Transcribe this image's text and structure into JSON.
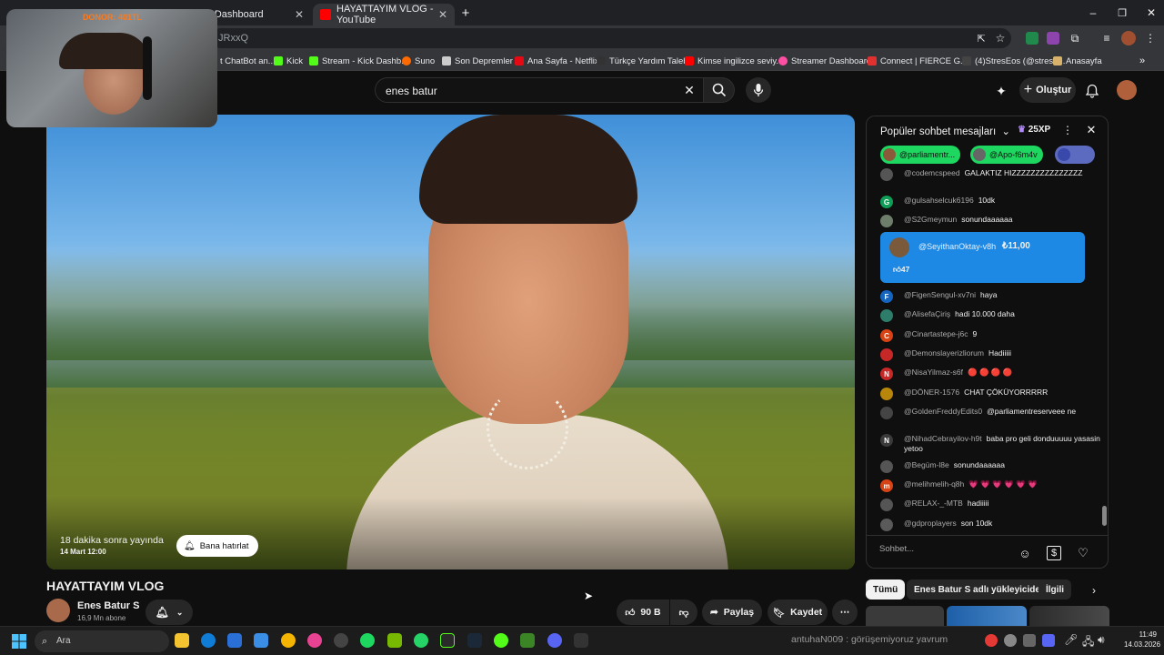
{
  "browser": {
    "tabs": [
      {
        "label": "Kick Dashboard",
        "icon_color": "#53fc18"
      },
      {
        "label": "HAYATTAYIM VLOG - YouTube",
        "icon_color": "#ff0000"
      }
    ],
    "new_tab_label": "+",
    "address": "JRxxQ",
    "bookmarks": [
      {
        "label": "t ChatBot an...",
        "color": "#aaaaaa"
      },
      {
        "label": "Kick",
        "color": "#53fc18"
      },
      {
        "label": "Stream - Kick Dashb...",
        "color": "#53fc18"
      },
      {
        "label": "Suno",
        "color": "#ff6a00"
      },
      {
        "label": "Son Depremler",
        "color": "#cccccc"
      },
      {
        "label": "Ana Sayfa - Netflix",
        "color": "#e50914"
      },
      {
        "label": "Türkçe Yardım Talebi",
        "color": "#333333"
      },
      {
        "label": "Kimse ingilizce seviy...",
        "color": "#ff0000"
      },
      {
        "label": "Streamer Dashboard",
        "color": "#ff4fa3"
      },
      {
        "label": "Connect | FIERCE G...",
        "color": "#e03030"
      },
      {
        "label": "(4)StresEos (@strese...",
        "color": "#444444"
      },
      {
        "label": "Anasayfa",
        "color": "#d8b26a"
      }
    ]
  },
  "overlay": {
    "donation": "DONOR: 401TL"
  },
  "header": {
    "search_value": "enes batur",
    "create_label": "Oluştur"
  },
  "video": {
    "upcoming_text": "18 dakika sonra yayında",
    "upcoming_date": "14 Mart 12:00",
    "remind_label": "Bana hatırlat",
    "title": "HAYATTAYIM VLOG",
    "channel_name": "Enes Batur S",
    "subscribers": "16,9 Mn abone",
    "likes": "90 B",
    "share_label": "Paylaş",
    "save_label": "Kaydet"
  },
  "chat": {
    "header_title": "Popüler sohbet mesajları",
    "xp_label": "25XP",
    "chips": [
      "@parliamentr...",
      "@Apo-f6m4v"
    ],
    "messages": [
      {
        "author": "@codemcspeed",
        "text": "GALAKTIZ HIZZZZZZZZZZZZZZZ",
        "avatar": "",
        "color": "#555555"
      },
      {
        "author": "@gulsahselcuk6196",
        "text": "10dk",
        "avatar": "G",
        "color": "#0f9d58"
      },
      {
        "author": "@S2Gmeymun",
        "text": "sonundaaaaaa",
        "avatar": "",
        "color": "#6d7f6b"
      },
      {
        "author": "@FigenSengul-xv7ni",
        "text": "haya",
        "avatar": "F",
        "color": "#1565c0"
      },
      {
        "author": "@AlisefaÇiriş",
        "text": "hadi 10.000 daha",
        "avatar": "",
        "color": "#2e7d6b"
      },
      {
        "author": "@Cinartastepe-j6c",
        "text": "9",
        "avatar": "C",
        "color": "#d84315"
      },
      {
        "author": "@Demonslayerizliorum",
        "text": "Hadiiiii",
        "avatar": "",
        "color": "#c62828"
      },
      {
        "author": "@NisaYilmaz-s6f",
        "text": "🔴 🔴 🔴 🔴",
        "avatar": "N",
        "color": "#c62828"
      },
      {
        "author": "@DÖNER-1576",
        "text": "CHAT ÇÖKÜYORRRRR",
        "avatar": "",
        "color": "#b8860b"
      },
      {
        "author": "@GoldenFreddyEdits0",
        "text": "@parliamentreserveee ne",
        "avatar": "",
        "color": "#444444"
      },
      {
        "author": "@NihadCebrayilov-h9t",
        "text": "baba pro geli donduuuuu yasasin yetoo",
        "avatar": "N",
        "color": "#3a3a3a"
      },
      {
        "author": "@Begüm-l8e",
        "text": "sonundaaaaaa",
        "avatar": "",
        "color": "#555555"
      },
      {
        "author": "@melihmelih-q8h",
        "text": "💗 💗 💗 💗 💗 💗",
        "avatar": "m",
        "color": "#d84315"
      },
      {
        "author": "@RELAX-_-MTB",
        "text": "hadiiiii",
        "avatar": "",
        "color": "#555555"
      },
      {
        "author": "@gdproplayers",
        "text": "son 10dk",
        "avatar": "",
        "color": "#5a5a5a"
      }
    ],
    "superchat": {
      "author": "@SeyithanOktay-v8h",
      "amount": "₺11,00",
      "likes": "47"
    },
    "input_placeholder": "Sohbet..."
  },
  "related_tabs": [
    "Tümü",
    "Enes Batur S adlı yükleyiciden",
    "İlgili"
  ],
  "taskbar": {
    "search_label": "Ara",
    "ticker": "antuhaN009 : görüşemiyoruz yavrum",
    "time": "11:49",
    "date": "14.03.2026"
  }
}
